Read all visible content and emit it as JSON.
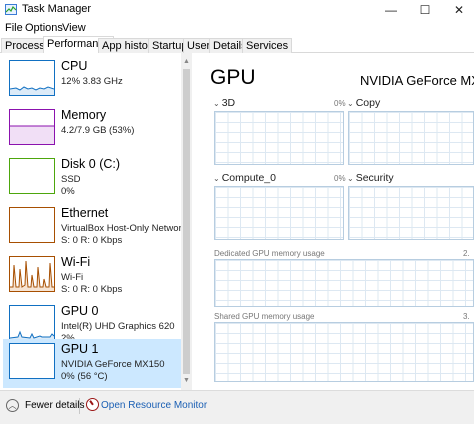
{
  "window": {
    "title": "Task Manager",
    "minimize_glyph": "—",
    "maximize_glyph": "☐",
    "close_glyph": "✕"
  },
  "menu": [
    "File",
    "Options",
    "View"
  ],
  "tabs": [
    {
      "label": "Processes",
      "active": false
    },
    {
      "label": "Performance",
      "active": true
    },
    {
      "label": "App history",
      "active": false
    },
    {
      "label": "Startup",
      "active": false
    },
    {
      "label": "Users",
      "active": false
    },
    {
      "label": "Details",
      "active": false
    },
    {
      "label": "Services",
      "active": false
    }
  ],
  "sidebar": {
    "items": [
      {
        "name": "CPU",
        "line1": "12%  3.83 GHz",
        "line2": "",
        "color": "#1170c2",
        "selected": false,
        "icon": "cpu-graph-icon"
      },
      {
        "name": "Memory",
        "line1": "4.2/7.9 GB (53%)",
        "line2": "",
        "color": "#8b12ae",
        "selected": false,
        "icon": "memory-graph-icon"
      },
      {
        "name": "Disk 0 (C:)",
        "line1": "SSD",
        "line2": "0%",
        "color": "#4da60c",
        "selected": false,
        "icon": "disk-graph-icon"
      },
      {
        "name": "Ethernet",
        "line1": "VirtualBox Host-Only Network",
        "line2": "S: 0  R: 0 Kbps",
        "color": "#a74f01",
        "selected": false,
        "icon": "ethernet-graph-icon"
      },
      {
        "name": "Wi-Fi",
        "line1": "Wi-Fi",
        "line2": "S: 0  R: 0 Kbps",
        "color": "#a74f01",
        "selected": false,
        "icon": "wifi-graph-icon"
      },
      {
        "name": "GPU 0",
        "line1": "Intel(R) UHD Graphics 620",
        "line2": "2%",
        "color": "#1170c2",
        "selected": false,
        "icon": "gpu0-graph-icon"
      },
      {
        "name": "GPU 1",
        "line1": "NVIDIA GeForce MX150",
        "line2": "0%  (56 °C)",
        "color": "#1170c2",
        "selected": true,
        "icon": "gpu1-graph-icon"
      }
    ]
  },
  "main": {
    "title": "GPU",
    "device_name": "NVIDIA GeForce MX",
    "graphs": [
      {
        "label": "3D",
        "pct": "0%"
      },
      {
        "label": "Copy",
        "pct": ""
      },
      {
        "label": "Compute_0",
        "pct": "0%"
      },
      {
        "label": "Security",
        "pct": ""
      }
    ],
    "dedicated_label": "Dedicated GPU memory usage",
    "dedicated_value": "2.",
    "shared_label": "Shared GPU memory usage",
    "shared_value": "3."
  },
  "footer": {
    "fewer_details": "Fewer details",
    "open_resource_monitor": "Open Resource Monitor"
  },
  "colors": {
    "selected_bg": "#cce8ff",
    "link": "#1a5fb4",
    "graph_border": "#b7cde0"
  }
}
